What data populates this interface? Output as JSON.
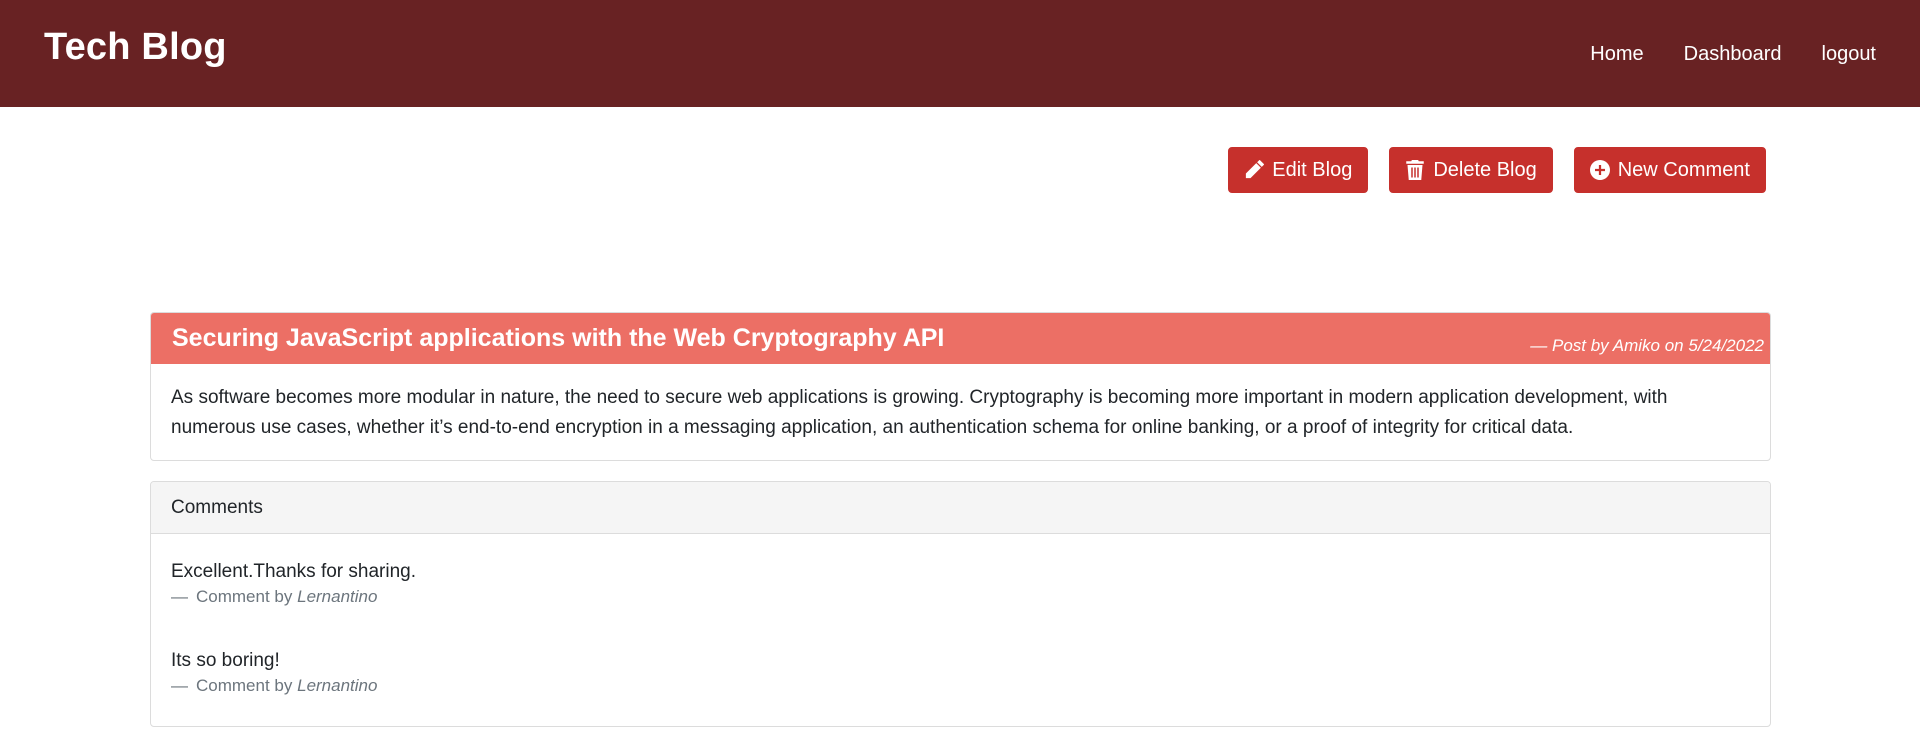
{
  "navbar": {
    "brand": "Tech Blog",
    "links": [
      "Home",
      "Dashboard",
      "logout"
    ]
  },
  "toolbar": {
    "edit_label": "Edit Blog",
    "delete_label": "Delete Blog",
    "new_comment_label": "New Comment"
  },
  "post": {
    "title": "Securing JavaScript applications with the Web Cryptography API",
    "meta": "— Post by Amiko on 5/24/2022",
    "body": "As software becomes more modular in nature, the need to secure web applications is growing. Cryptography is becoming more important in modern application development, with numerous use cases, whether it’s end-to-end encryption in a messaging application, an authentication schema for online banking, or a proof of integrity for critical data."
  },
  "comments": {
    "header": "Comments",
    "items": [
      {
        "text": "Excellent.Thanks for sharing.",
        "dash": "—",
        "prefix": "Comment by",
        "author": "Lernantino"
      },
      {
        "text": "Its so boring!",
        "dash": "—",
        "prefix": "Comment by",
        "author": "Lernantino"
      }
    ]
  },
  "icons": {
    "edit": "pencil-icon",
    "delete": "trash-icon",
    "new_comment": "plus-circle-icon"
  },
  "colors": {
    "navbar": "#682223",
    "button": "#c6302c",
    "post_header": "#ec6f65",
    "comments_header": "#f5f5f5"
  }
}
